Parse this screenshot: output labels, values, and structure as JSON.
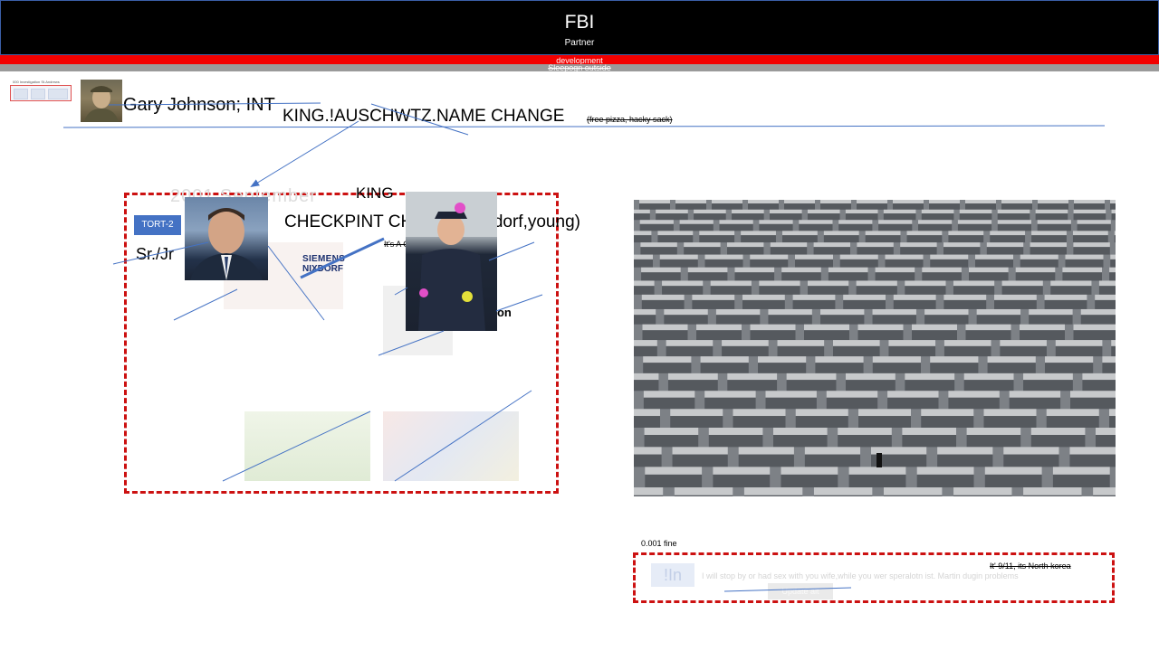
{
  "header": {
    "title": "FBI",
    "subtitle": "Partner",
    "red_bar_label": "development",
    "gray_bar_label": "Sleepogn outside"
  },
  "thumbnail": {
    "caption": "000 Investigation St.Andrews"
  },
  "people": {
    "name_line": "Gary Johnson; INT",
    "change_line": "KING.!AUSCHWTZ.NAME CHANGE",
    "change_aside": "(free pizza, hacky sack)"
  },
  "frame_left": {
    "ghost_label": "2001 September",
    "king_label": "KING",
    "badge": "TORT-2",
    "checkpoint": "CHECKPINT CHARLIE(Nixdorf,young)",
    "small_note": "It's A Good-Tip | A ride of idiots",
    "suffix": "Sr./Jr",
    "logo_line1": "SIEMENS",
    "logo_line2": "NIXDORF",
    "tion_text": "tion"
  },
  "frame_bottom": {
    "fine_label": "0.001 fine",
    "faded_badge": "!In",
    "faded_sentence": "I will stop by or had sex with you wife,while you wer speralotn ist. Martin dugin problems",
    "faded_button": "Update alt",
    "note": "It' 9/11, its North korea"
  },
  "icons": {
    "soldier": "soldier-portrait-icon",
    "nixon": "nixon-portrait-icon",
    "police": "police-officer-photo-icon",
    "memorial": "memorial-blocks-photo-icon"
  },
  "colors": {
    "header_bg": "#000000",
    "red_bar": "#f20000",
    "gray_bar": "#9a9a9a",
    "badge_blue": "#4472c4",
    "frame_red": "#cc1111",
    "connector_blue": "#4472c4"
  }
}
